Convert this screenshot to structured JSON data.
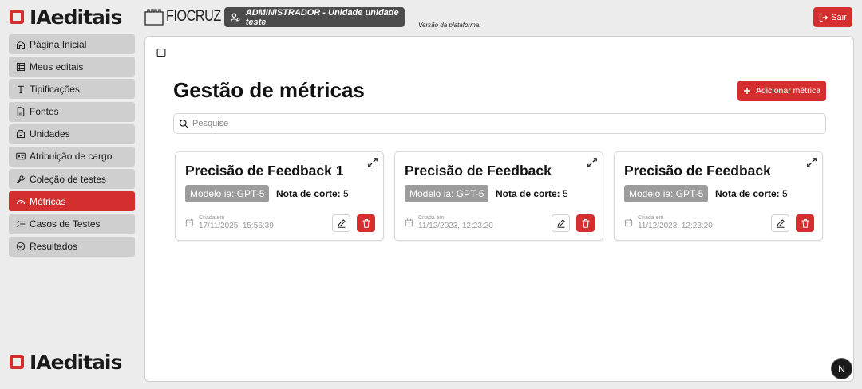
{
  "header": {
    "logo_text": "IAeditais",
    "partner_logo_text": "FIOCRUZ",
    "user_badge": "ADMINISTRADOR - Unidade unidade teste",
    "platform_version_label": "Versão da plataforma:",
    "logout_label": "Sair"
  },
  "sidebar": {
    "items": [
      {
        "label": "Página Inicial",
        "icon": "home-icon"
      },
      {
        "label": "Meus editais",
        "icon": "table-icon"
      },
      {
        "label": "Tipificações",
        "icon": "text-type-icon"
      },
      {
        "label": "Fontes",
        "icon": "file-icon"
      },
      {
        "label": "Unidades",
        "icon": "building-icon"
      },
      {
        "label": "Atribuição de cargo",
        "icon": "id-card-icon"
      },
      {
        "label": "Coleção de testes",
        "icon": "wrench-icon"
      },
      {
        "label": "Métricas",
        "icon": "gauge-icon",
        "active": true
      },
      {
        "label": "Casos de Testes",
        "icon": "list-checks-icon"
      },
      {
        "label": "Resultados",
        "icon": "check-circle-icon"
      }
    ],
    "footer_logo_text": "IAeditais"
  },
  "main": {
    "title": "Gestão de métricas",
    "add_button_label": "Adicionar métrica",
    "search_placeholder": "Pesquise",
    "cards": [
      {
        "title": "Precisão de Feedback 1",
        "model_badge": "Modelo ia: GPT-5",
        "cutoff_label": "Nota de corte:",
        "cutoff_value": "5",
        "created_label": "Criada em",
        "created_date": "17/11/2025, 15:56:39"
      },
      {
        "title": "Precisão de Feedback",
        "model_badge": "Modelo ia: GPT-5",
        "cutoff_label": "Nota de corte:",
        "cutoff_value": "5",
        "created_label": "Criada em",
        "created_date": "11/12/2023, 12:23:20"
      },
      {
        "title": "Precisão de Feedback",
        "model_badge": "Modelo ia: GPT-5",
        "cutoff_label": "Nota de corte:",
        "cutoff_value": "5",
        "created_label": "Criada em",
        "created_date": "11/12/2023, 12:23:20"
      }
    ]
  },
  "floating_badge": "N",
  "colors": {
    "accent": "#d42e2e",
    "badge_dark": "#4c4c4c",
    "nav_bg": "#cfcfcf",
    "model_badge": "#9c9c9c"
  }
}
